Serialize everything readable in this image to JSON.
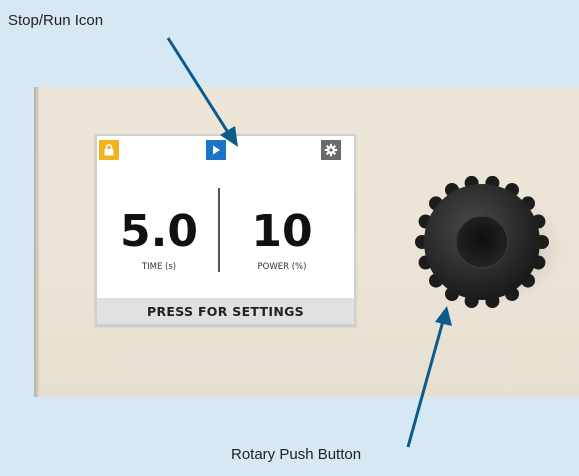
{
  "callouts": {
    "stop_run_icon": "Stop/Run Icon",
    "rotary_push_button": "Rotary Push Button"
  },
  "display": {
    "time_value": "5.0",
    "time_label": "TIME (s)",
    "power_value": "10",
    "power_label": "POWER (%)",
    "settings_prompt": "PRESS FOR SETTINGS"
  },
  "icons": {
    "lock": "lock-icon",
    "run": "play-icon",
    "settings": "gear-icon",
    "knob": "rotary-knob"
  },
  "colors": {
    "background": "#d6e8f4",
    "lock_icon_bg": "#f1b21c",
    "run_icon_bg": "#1b74c5",
    "settings_icon_bg": "#6a6a6a",
    "arrow": "#0d5a8c",
    "panel": "#ebe4d6"
  }
}
